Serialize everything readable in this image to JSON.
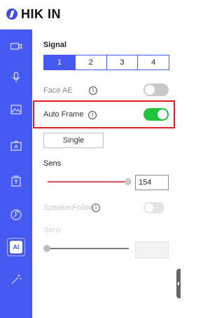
{
  "app": {
    "title": "HIK IN"
  },
  "sidebar": {
    "items": [
      {
        "icon": "camera-icon"
      },
      {
        "icon": "microphone-icon"
      },
      {
        "icon": "image-icon"
      },
      {
        "icon": "picture-settings-icon"
      },
      {
        "icon": "text-overlay-icon"
      },
      {
        "icon": "wrench-icon"
      },
      {
        "icon": "ai-icon",
        "label": "AI",
        "active": true
      },
      {
        "icon": "magic-wand-icon"
      }
    ]
  },
  "signal": {
    "label": "Signal",
    "options": [
      "1",
      "2",
      "3",
      "4"
    ],
    "selected": "1"
  },
  "face_ae": {
    "label": "Face AE",
    "info": "i",
    "on": false
  },
  "auto_frame": {
    "label": "Auto Frame",
    "info": "i",
    "on": true,
    "mode_button": "Single"
  },
  "sens": {
    "label": "Sens",
    "value": "154"
  },
  "speaker_follow": {
    "label": "SpeakerFollow",
    "info": "i",
    "on": false,
    "enabled": false
  },
  "sens2": {
    "label": "Sens",
    "value": "",
    "enabled": false
  },
  "colors": {
    "accent": "#4559f3",
    "toggle_on": "#1fc43c",
    "highlight": "#e02020",
    "slider": "#e0505a"
  }
}
